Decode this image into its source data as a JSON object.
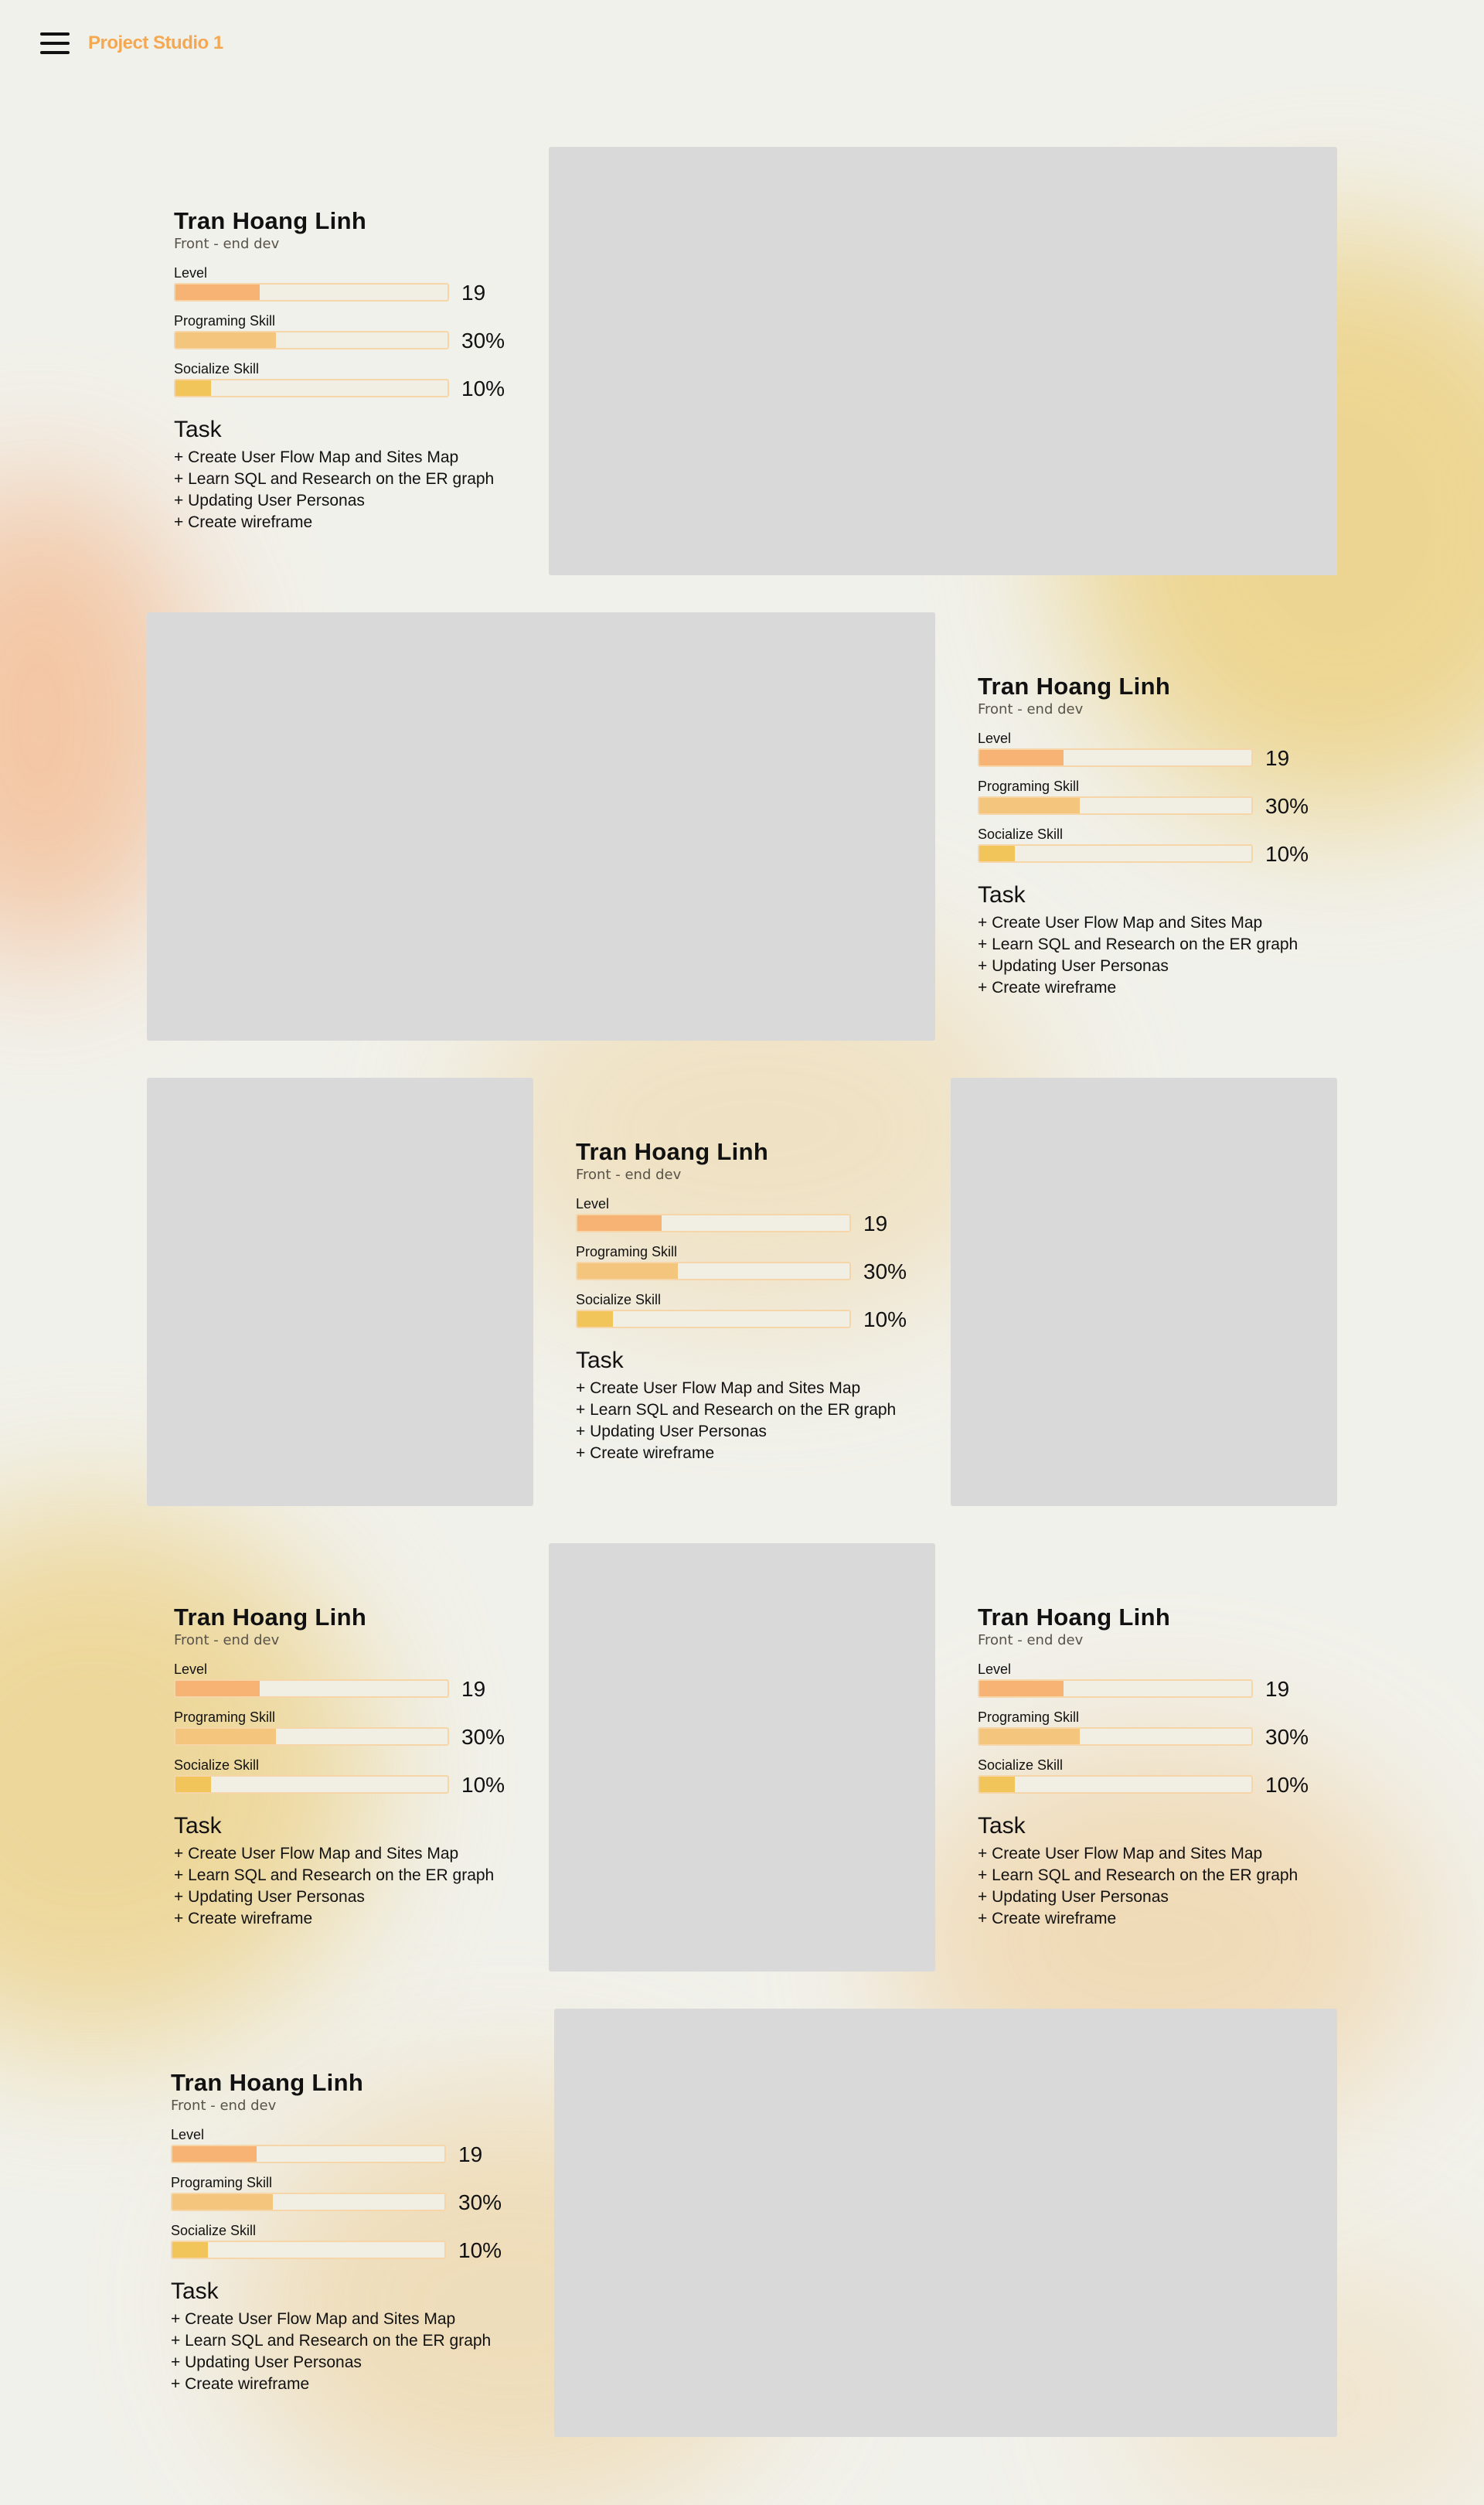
{
  "header": {
    "brand": "Project Studio 1"
  },
  "profile": {
    "name": "Tran Hoang Linh",
    "role": "Front - end dev",
    "stats": [
      {
        "label": "Level",
        "value": "19",
        "fill": 0.31,
        "color": "#f6b374"
      },
      {
        "label": "Programing Skill",
        "value": "30%",
        "fill": 0.37,
        "color": "#f4c57c"
      },
      {
        "label": "Socialize Skill",
        "value": "10%",
        "fill": 0.13,
        "color": "#f1c55a"
      }
    ],
    "task_title": "Task",
    "tasks": [
      "+ Create User Flow Map and Sites Map",
      "+ Learn SQL and Research on the ER graph",
      "+ Updating User Personas",
      "+ Create wireframe"
    ]
  }
}
